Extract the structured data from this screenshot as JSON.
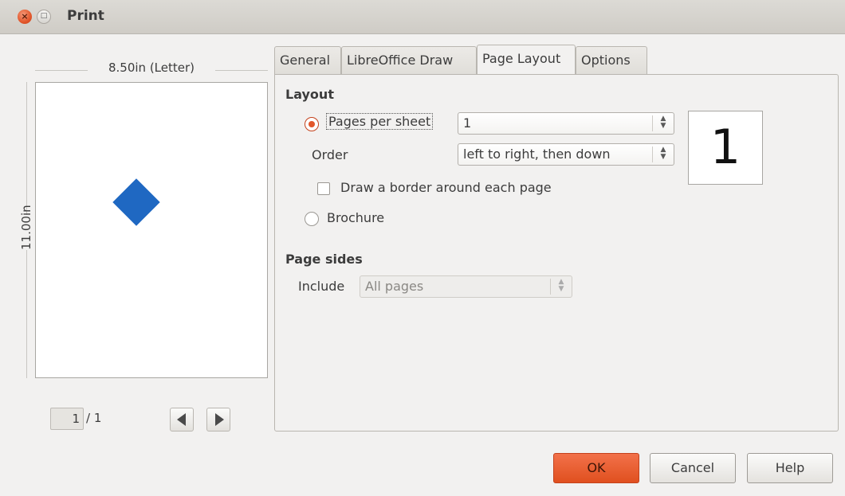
{
  "window": {
    "title": "Print",
    "close_glyph": "×",
    "max_glyph": "□"
  },
  "preview": {
    "width_label": "8.50in (Letter)",
    "height_label": "11.00in",
    "current_page": "1",
    "total_pages": "/ 1",
    "shape_color": "#1f68c2"
  },
  "tabs": [
    {
      "label": "General"
    },
    {
      "label": "LibreOffice Draw"
    },
    {
      "label": "Page Layout",
      "active": true
    },
    {
      "label": "Options"
    }
  ],
  "layout": {
    "section_title": "Layout",
    "pages_per_sheet_label": "Pages per sheet",
    "pages_per_sheet_value": "1",
    "order_label": "Order",
    "order_value": "left to right, then down",
    "draw_border_label": "Draw a border around each page",
    "brochure_label": "Brochure",
    "preview_number": "1"
  },
  "page_sides": {
    "section_title": "Page sides",
    "include_label": "Include",
    "include_value": "All pages"
  },
  "buttons": {
    "ok": "OK",
    "cancel": "Cancel",
    "help": "Help"
  },
  "colors": {
    "accent": "#e2562a",
    "background": "#f2f1f0"
  }
}
